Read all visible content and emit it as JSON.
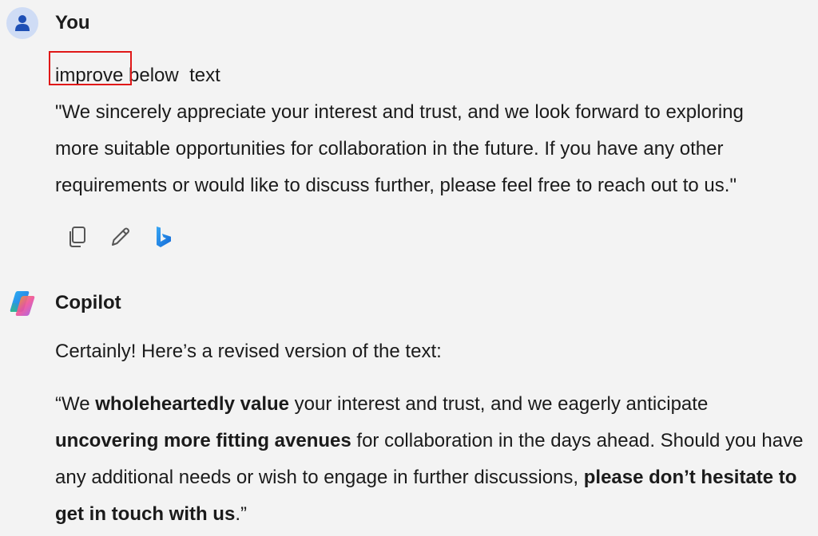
{
  "user_message": {
    "sender": "You",
    "prompt": {
      "highlighted_word": "improve",
      "rest": "below  text"
    },
    "quoted_lines": [
      "\"We sincerely appreciate your interest and trust, and we look forward to exploring",
      "more suitable opportunities for collaboration in the future. If you have any other",
      "requirements or would like to discuss further, please feel free to reach out to us.\""
    ],
    "actions": [
      {
        "name": "copy",
        "icon": "copy-icon"
      },
      {
        "name": "edit",
        "icon": "pencil-icon"
      },
      {
        "name": "bing",
        "icon": "bing-icon"
      }
    ],
    "highlight_color": "#e01818"
  },
  "copilot_message": {
    "sender": "Copilot",
    "intro": "Certainly! Here’s a revised version of the text:",
    "revised": {
      "p1": "“We ",
      "b1": "wholeheartedly value",
      "p2": " your interest and trust, and we eagerly anticipate ",
      "b2": "uncovering more fitting avenues",
      "p3": " for collaboration in the days ahead. Should you have any additional needs or wish to engage in further discussions, ",
      "b3": "please don’t hesitate to get in touch with us",
      "p4": ".”"
    }
  },
  "colors": {
    "background": "#f3f3f3",
    "user_avatar_bg": "#cfdcf5",
    "user_avatar_icon": "#1e4fb5",
    "text": "#1b1b1b"
  }
}
